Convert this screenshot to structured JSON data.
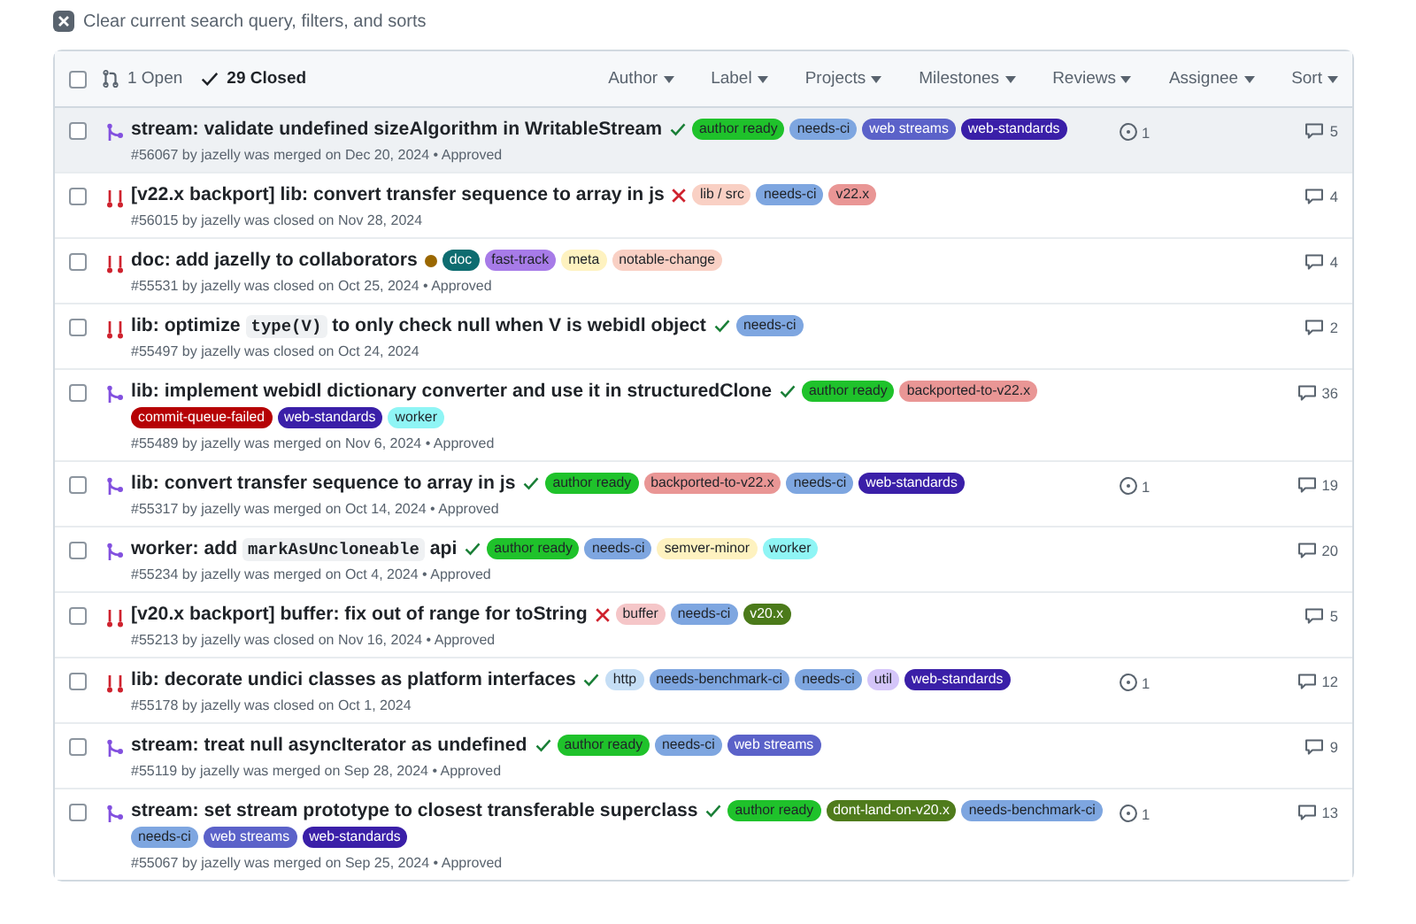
{
  "clear_filter": {
    "label": "Clear current search query, filters, and sorts"
  },
  "list_header": {
    "checked": false,
    "open_count": "1 Open",
    "closed_count": "29 Closed",
    "filters": [
      "Author",
      "Label",
      "Projects",
      "Milestones",
      "Reviews",
      "Assignee",
      "Sort"
    ]
  },
  "pull_requests": [
    {
      "kind": "merged",
      "selected": true,
      "checked": false,
      "title": [
        {
          "kind": "text",
          "text": "stream: validate undefined sizeAlgorithm in WritableStream"
        }
      ],
      "check": {
        "kind": "success"
      },
      "labels": [
        {
          "name": "author ready",
          "color": "#1fc22b"
        },
        {
          "name": "needs-ci",
          "color": "#7ea6e0"
        },
        {
          "name": "web streams",
          "color": "#5b62c9"
        },
        {
          "name": "web-standards",
          "color": "#3a1fa8"
        }
      ],
      "meta": "#56067 by jazelly was merged on Dec 20, 2024 • Approved",
      "linked": "1",
      "comments": "5"
    },
    {
      "kind": "closed",
      "selected": false,
      "checked": false,
      "title": [
        {
          "kind": "text",
          "text": "[v22.x backport] lib: convert transfer sequence to array in js"
        }
      ],
      "check": {
        "kind": "failure"
      },
      "labels": [
        {
          "name": "lib / src",
          "color": "#f9d0c4"
        },
        {
          "name": "needs-ci",
          "color": "#7ea6e0"
        },
        {
          "name": "v22.x",
          "color": "#e99695"
        }
      ],
      "meta": "#56015 by jazelly was closed on Nov 28, 2024",
      "comments": "4"
    },
    {
      "kind": "closed",
      "selected": false,
      "checked": false,
      "title": [
        {
          "kind": "text",
          "text": "doc: add jazelly to collaborators"
        }
      ],
      "check": {
        "kind": "pending"
      },
      "labels": [
        {
          "name": "doc",
          "color": "#0e6c70"
        },
        {
          "name": "fast-track",
          "color": "#a77be8"
        },
        {
          "name": "meta",
          "color": "#fef2c0"
        },
        {
          "name": "notable-change",
          "color": "#f9d0c4"
        }
      ],
      "meta": "#55531 by jazelly was closed on Oct 25, 2024 • Approved",
      "comments": "4"
    },
    {
      "kind": "closed",
      "selected": false,
      "checked": false,
      "title": [
        {
          "kind": "text",
          "text": "lib: optimize "
        },
        {
          "kind": "code",
          "text": "type(V)"
        },
        {
          "kind": "text",
          "text": " to only check null when V is webidl object"
        }
      ],
      "check": {
        "kind": "success"
      },
      "labels": [
        {
          "name": "needs-ci",
          "color": "#7ea6e0"
        }
      ],
      "meta": "#55497 by jazelly was closed on Oct 24, 2024",
      "comments": "2"
    },
    {
      "kind": "merged",
      "selected": false,
      "checked": false,
      "title": [
        {
          "kind": "text",
          "text": "lib: implement webidl dictionary converter and use it in structuredClone"
        }
      ],
      "check": {
        "kind": "success"
      },
      "labels": [
        {
          "name": "author ready",
          "color": "#1fc22b"
        },
        {
          "name": "backported-to-v22.x",
          "color": "#e99695"
        },
        {
          "name": "commit-queue-failed",
          "color": "#b60205"
        },
        {
          "name": "web-standards",
          "color": "#3a1fa8"
        },
        {
          "name": "worker",
          "color": "#8ff5f5"
        }
      ],
      "meta": "#55489 by jazelly was merged on Nov 6, 2024 • Approved",
      "comments": "36"
    },
    {
      "kind": "merged",
      "selected": false,
      "checked": false,
      "title": [
        {
          "kind": "text",
          "text": "lib: convert transfer sequence to array in js"
        }
      ],
      "check": {
        "kind": "success"
      },
      "labels": [
        {
          "name": "author ready",
          "color": "#1fc22b"
        },
        {
          "name": "backported-to-v22.x",
          "color": "#e99695"
        },
        {
          "name": "needs-ci",
          "color": "#7ea6e0"
        },
        {
          "name": "web-standards",
          "color": "#3a1fa8"
        }
      ],
      "meta": "#55317 by jazelly was merged on Oct 14, 2024 • Approved",
      "linked": "1",
      "comments": "19"
    },
    {
      "kind": "merged",
      "selected": false,
      "checked": false,
      "title": [
        {
          "kind": "text",
          "text": "worker: add "
        },
        {
          "kind": "code",
          "text": "markAsUncloneable"
        },
        {
          "kind": "text",
          "text": " api"
        }
      ],
      "check": {
        "kind": "success"
      },
      "labels": [
        {
          "name": "author ready",
          "color": "#1fc22b"
        },
        {
          "name": "needs-ci",
          "color": "#7ea6e0"
        },
        {
          "name": "semver-minor",
          "color": "#fef2c0"
        },
        {
          "name": "worker",
          "color": "#8ff5f5"
        }
      ],
      "meta": "#55234 by jazelly was merged on Oct 4, 2024 • Approved",
      "comments": "20"
    },
    {
      "kind": "closed",
      "selected": false,
      "checked": false,
      "title": [
        {
          "kind": "text",
          "text": "[v20.x backport] buffer: fix out of range for toString"
        }
      ],
      "check": {
        "kind": "failure"
      },
      "labels": [
        {
          "name": "buffer",
          "color": "#f5c6c8"
        },
        {
          "name": "needs-ci",
          "color": "#7ea6e0"
        },
        {
          "name": "v20.x",
          "color": "#4b7a1a"
        }
      ],
      "meta": "#55213 by jazelly was closed on Nov 16, 2024 • Approved",
      "comments": "5"
    },
    {
      "kind": "closed",
      "selected": false,
      "checked": false,
      "title": [
        {
          "kind": "text",
          "text": "lib: decorate undici classes as platform interfaces"
        }
      ],
      "check": {
        "kind": "success"
      },
      "labels": [
        {
          "name": "http",
          "color": "#c5def5"
        },
        {
          "name": "needs-benchmark-ci",
          "color": "#7ea6e0"
        },
        {
          "name": "needs-ci",
          "color": "#7ea6e0"
        },
        {
          "name": "util",
          "color": "#d4c5f9"
        },
        {
          "name": "web-standards",
          "color": "#3a1fa8"
        }
      ],
      "meta": "#55178 by jazelly was closed on Oct 1, 2024",
      "linked": "1",
      "comments": "12"
    },
    {
      "kind": "merged",
      "selected": false,
      "checked": false,
      "title": [
        {
          "kind": "text",
          "text": "stream: treat null asyncIterator as undefined"
        }
      ],
      "check": {
        "kind": "success"
      },
      "labels": [
        {
          "name": "author ready",
          "color": "#1fc22b"
        },
        {
          "name": "needs-ci",
          "color": "#7ea6e0"
        },
        {
          "name": "web streams",
          "color": "#5b62c9"
        }
      ],
      "meta": "#55119 by jazelly was merged on Sep 28, 2024 • Approved",
      "comments": "9"
    },
    {
      "kind": "merged",
      "selected": false,
      "checked": false,
      "title": [
        {
          "kind": "text",
          "text": "stream: set stream prototype to closest transferable superclass"
        }
      ],
      "check": {
        "kind": "success"
      },
      "labels": [
        {
          "name": "author ready",
          "color": "#1fc22b"
        },
        {
          "name": "dont-land-on-v20.x",
          "color": "#4f7b1c"
        },
        {
          "name": "needs-benchmark-ci",
          "color": "#7ea6e0"
        },
        {
          "name": "needs-ci",
          "color": "#7ea6e0"
        },
        {
          "name": "web streams",
          "color": "#5b62c9"
        },
        {
          "name": "web-standards",
          "color": "#3a1fa8"
        }
      ],
      "meta": "#55067 by jazelly was merged on Sep 25, 2024 • Approved",
      "linked": "1",
      "comments": "13"
    }
  ]
}
